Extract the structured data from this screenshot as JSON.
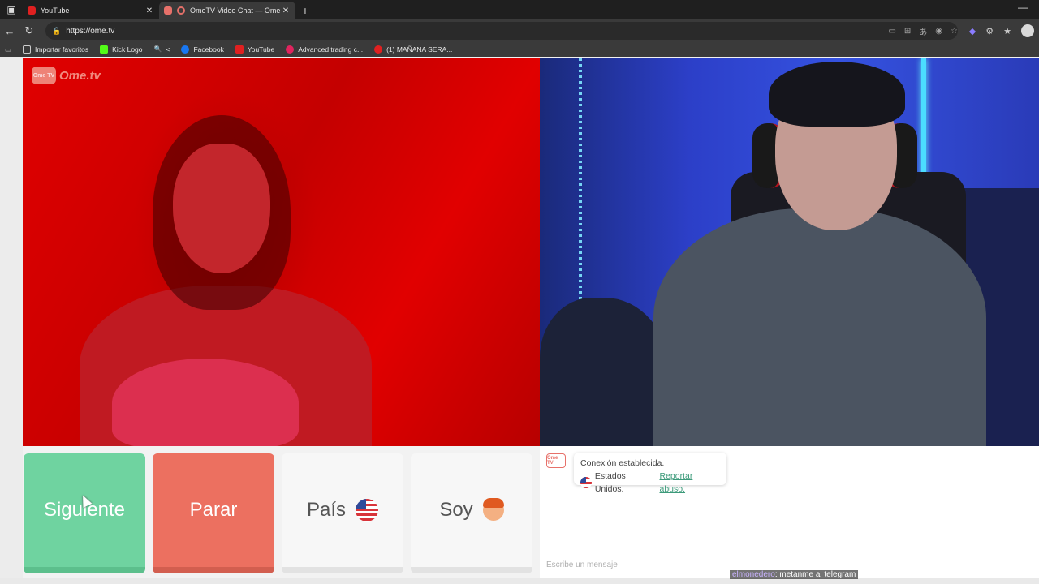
{
  "browser": {
    "tabs": [
      {
        "title": "YouTube",
        "close": "✕",
        "active": false
      },
      {
        "title": "OmeTV Video Chat — Ome",
        "close": "✕",
        "active": true
      }
    ],
    "new_tab": "+",
    "minimize": "—",
    "url": "https://ome.tv",
    "bookmarks": [
      {
        "label": "Importar favoritos"
      },
      {
        "label": "Kick Logo"
      },
      {
        "label": "<"
      },
      {
        "label": "Facebook"
      },
      {
        "label": "YouTube"
      },
      {
        "label": "Advanced trading c..."
      },
      {
        "label": "(1) MAÑANA SERA..."
      }
    ]
  },
  "site": {
    "logo_badge": "Ome TV",
    "logo_text": "Ome.tv"
  },
  "controls": {
    "next": "Siguiente",
    "stop": "Parar",
    "country": "País",
    "gender": "Soy"
  },
  "chat": {
    "logo_badge": "Ome TV",
    "status": "Conexión establecida.",
    "country": "Estados Unidos.",
    "report": "Reportar abuso.",
    "input_placeholder": "Escribe un mensaje"
  },
  "stream_overlay": {
    "user": "elmonedero",
    "message": ": metanme al telegram"
  },
  "colors": {
    "next": "#6fd3a0",
    "stop": "#ec7060",
    "neutral_button": "#f7f7f7",
    "report_link": "#3c9a7a",
    "brand": "#e7716a"
  }
}
